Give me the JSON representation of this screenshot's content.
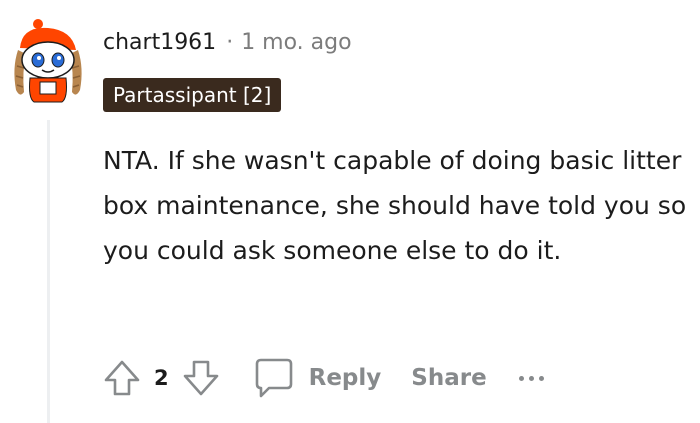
{
  "comment": {
    "author": "chart1961",
    "separator": "·",
    "timestamp": "1 mo. ago",
    "flair": "Partassipant [2]",
    "body": "NTA. If she wasn't capable of doing basic litter box maintenance, she should have told you so you could ask someone else to do it.",
    "vote_count": "2",
    "reply_label": "Reply",
    "share_label": "Share"
  },
  "colors": {
    "flair_bg": "#3a2a1e",
    "muted": "#878a8c",
    "text": "#1c1c1c",
    "avatar_accent": "#ff4500"
  },
  "icons": [
    "upvote-icon",
    "downvote-icon",
    "comment-bubble-icon",
    "more-options-icon"
  ]
}
